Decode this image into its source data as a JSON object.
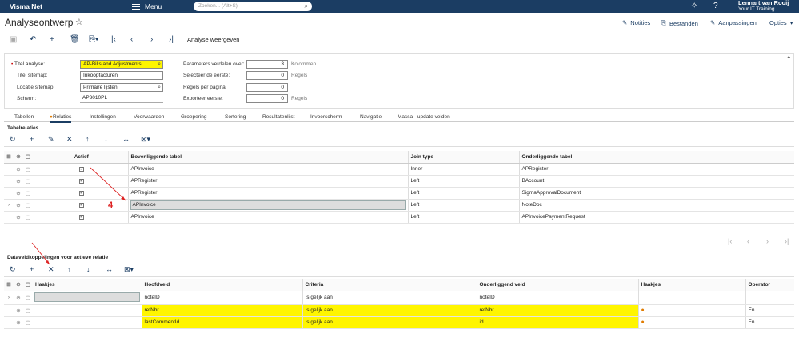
{
  "topbar": {
    "brand": "Visma Net",
    "menu_label": "Menu",
    "search_placeholder": "Zoeken... (Alt+S)",
    "user_name": "Lennart van Rooij",
    "user_company": "Your IT Training"
  },
  "page": {
    "title": "Analyseontwerp",
    "links": [
      "Notities",
      "Bestanden",
      "Aanpassingen",
      "Opties"
    ]
  },
  "toolbar": {
    "action_label": "Analyse weergeven"
  },
  "form": {
    "titel_analyse_label": "Titel analyse:",
    "titel_analyse_value": "AP-Bills and Adjustments",
    "titel_sitemap_label": "Titel sitemap:",
    "titel_sitemap_value": "Inkoopfacturen",
    "locatie_sitemap_label": "Locatie sitemap:",
    "locatie_sitemap_value": "Primaire lijsten",
    "scherm_label": "Scherm:",
    "scherm_value": "AP3010PL",
    "parameters_label": "Parameters verdelen over:",
    "parameters_value": "3",
    "parameters_unit": "Kolommen",
    "selecteer_label": "Selecteer de eerste:",
    "selecteer_value": "0",
    "selecteer_unit": "Regels",
    "regels_label": "Regels per pagina:",
    "regels_value": "0",
    "exporteer_label": "Exporteer eerste:",
    "exporteer_value": "0",
    "exporteer_unit": "Regels"
  },
  "tabs": [
    "Tabellen",
    "Relaties",
    "Instellingen",
    "Voorwaarden",
    "Groepering",
    "Sortering",
    "Resultatenlijst",
    "Invoerscherm",
    "Navigatie",
    "Massa - update velden"
  ],
  "relations": {
    "section_title": "Tabelrelaties",
    "headers": [
      "Actief",
      "Bovenliggende tabel",
      "Join type",
      "Onderliggende tabel"
    ],
    "rows": [
      {
        "parent": "APInvoice",
        "join": "Inner",
        "child": "APRegister"
      },
      {
        "parent": "APRegister",
        "join": "Left",
        "child": "BAccount"
      },
      {
        "parent": "APRegister",
        "join": "Left",
        "child": "SigmaApprovalDocument"
      },
      {
        "parent": "APInvoice",
        "join": "Left",
        "child": "NoteDoc"
      },
      {
        "parent": "APInvoice",
        "join": "Left",
        "child": "APInvoicePaymentRequest"
      }
    ]
  },
  "fields": {
    "section_title": "Dataveldkoppelingen voor actieve relatie",
    "headers": [
      "Haakjes",
      "Hoofdveld",
      "Criteria",
      "Onderliggend veld",
      "Haakjes",
      "Operator"
    ],
    "rows": [
      {
        "main": "noteID",
        "criteria": "Is gelijk aan",
        "child": "noteID",
        "operator": ""
      },
      {
        "main": "refNbr",
        "criteria": "Is gelijk aan",
        "child": "refNbr",
        "operator": "En"
      },
      {
        "main": "lastCommentId",
        "criteria": "Is gelijk aan",
        "child": "id",
        "operator": "En"
      }
    ]
  },
  "annotation": "4"
}
